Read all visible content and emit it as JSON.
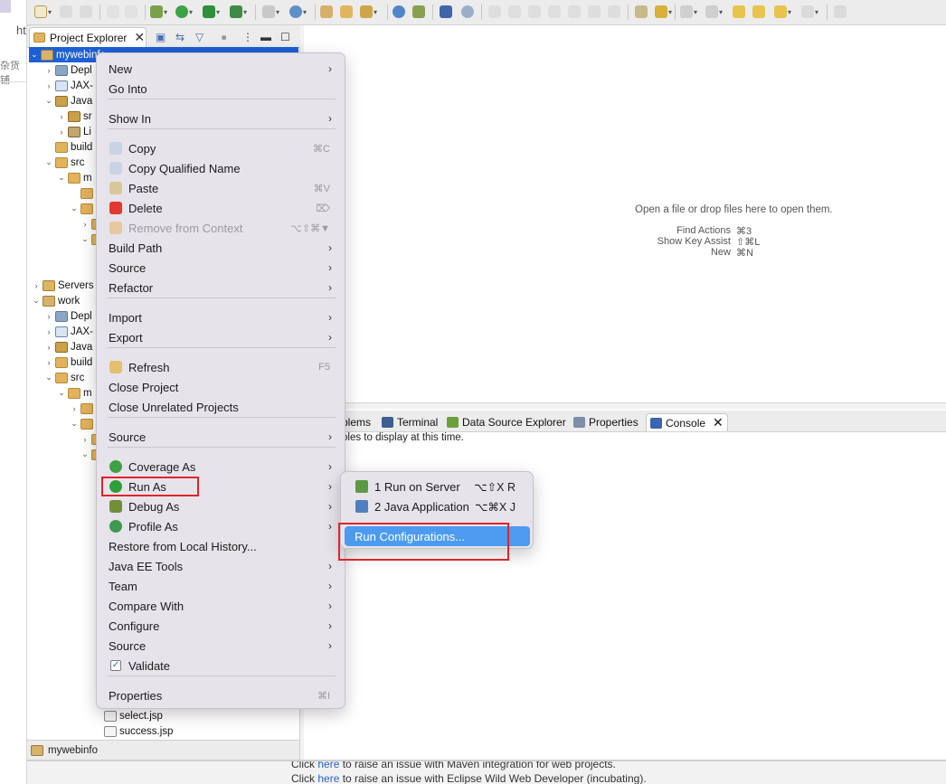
{
  "background": {
    "frag1": "ht",
    "frag2": "杂货铺"
  },
  "web_page": {
    "line1_prefix": "Click",
    "line1_link": "here",
    "line1_suffix": "to raise an issue with Maven integration for web projects.",
    "line2_prefix": "Click",
    "line2_link": "here",
    "line2_suffix": "to raise an issue with Eclipse Wild Web Developer (incubating)."
  },
  "explorer": {
    "tab_label": "Project Explorer",
    "close_glyph": "✕",
    "tree": [
      {
        "label": "mywebinfo",
        "arrow": "⌄",
        "icon": "proj"
      },
      {
        "label": "Depl",
        "arrow": "›",
        "icon": "deploy"
      },
      {
        "label": "JAX-",
        "arrow": "›",
        "icon": "jax"
      },
      {
        "label": "Java",
        "arrow": "⌄",
        "icon": "java"
      },
      {
        "label": "sr",
        "arrow": "›",
        "icon": "java"
      },
      {
        "label": "Li",
        "arrow": "›",
        "icon": "lib"
      },
      {
        "label": "build",
        "arrow": "",
        "icon": "folder"
      },
      {
        "label": "src",
        "arrow": "⌄",
        "icon": "folder"
      },
      {
        "label": "m",
        "arrow": "⌄",
        "icon": "folder"
      },
      {
        "label": "",
        "arrow": "",
        "icon": "folder"
      },
      {
        "label": "",
        "arrow": "⌄",
        "icon": "folder"
      },
      {
        "label": "",
        "arrow": "›",
        "icon": "folder"
      },
      {
        "label": "",
        "arrow": "⌄",
        "icon": "folder"
      },
      {
        "label": "Servers",
        "arrow": "›",
        "icon": "server"
      },
      {
        "label": "work",
        "arrow": "⌄",
        "icon": "proj"
      },
      {
        "label": "Depl",
        "arrow": "›",
        "icon": "deploy"
      },
      {
        "label": "JAX-",
        "arrow": "›",
        "icon": "jax"
      },
      {
        "label": "Java",
        "arrow": "›",
        "icon": "java"
      },
      {
        "label": "build",
        "arrow": "›",
        "icon": "folder"
      },
      {
        "label": "src",
        "arrow": "⌄",
        "icon": "folder"
      },
      {
        "label": "m",
        "arrow": "⌄",
        "icon": "folder"
      },
      {
        "label": "",
        "arrow": "›",
        "icon": "folder"
      },
      {
        "label": "",
        "arrow": "⌄",
        "icon": "folder"
      },
      {
        "label": "",
        "arrow": "›",
        "icon": "folder"
      },
      {
        "label": "",
        "arrow": "⌄",
        "icon": "folder"
      },
      {
        "label": "select.jsp",
        "arrow": "",
        "icon": "jsp"
      },
      {
        "label": "success.jsp",
        "arrow": "",
        "icon": "jsp"
      }
    ],
    "status_label": "mywebinfo"
  },
  "editor": {
    "hint_main": "Open a file or drop files here to open them.",
    "hints": [
      {
        "label": "Find Actions",
        "key": "⌘3"
      },
      {
        "label": "Show Key Assist",
        "key": "⇧⌘L"
      },
      {
        "label": "New",
        "key": "⌘N"
      }
    ]
  },
  "bottom_panel": {
    "tabs": [
      {
        "label": "blems",
        "icon_color": "#d26b3c"
      },
      {
        "label": "Terminal",
        "icon_color": "#3d5f8f"
      },
      {
        "label": "Data Source Explorer",
        "icon_color": "#6aa03c"
      },
      {
        "label": "Properties",
        "icon_color": "#7d8ea6"
      },
      {
        "label": "Console",
        "icon_color": "#3a64b4"
      }
    ],
    "close_glyph": "✕",
    "console_message": "oles to display at this time."
  },
  "context_menu": {
    "items": [
      {
        "label": "New",
        "arrow": "›",
        "shortcut": ""
      },
      {
        "label": "Go Into",
        "arrow": "",
        "shortcut": ""
      },
      {
        "label": "Show In",
        "arrow": "›",
        "shortcut": ""
      },
      {
        "label": "Copy",
        "arrow": "",
        "shortcut": "⌘C",
        "icon": "#c8d3e3"
      },
      {
        "label": "Copy Qualified Name",
        "arrow": "",
        "shortcut": "",
        "icon": "#c8d3e3"
      },
      {
        "label": "Paste",
        "arrow": "",
        "shortcut": "⌘V",
        "icon": "#d9c79b"
      },
      {
        "label": "Delete",
        "arrow": "",
        "shortcut": "⌦",
        "icon": "#e03a2e"
      },
      {
        "label": "Remove from Context",
        "arrow": "",
        "shortcut": "⌥⇧⌘▼",
        "icon": "#e6c9a0",
        "disabled": true
      },
      {
        "label": "Build Path",
        "arrow": "›",
        "shortcut": ""
      },
      {
        "label": "Source",
        "arrow": "›",
        "shortcut": ""
      },
      {
        "label": "Refactor",
        "arrow": "›",
        "shortcut": ""
      },
      {
        "label": "Import",
        "arrow": "›",
        "shortcut": ""
      },
      {
        "label": "Export",
        "arrow": "›",
        "shortcut": ""
      },
      {
        "label": "Refresh",
        "arrow": "",
        "shortcut": "F5",
        "icon": "#e2c070"
      },
      {
        "label": "Close Project",
        "arrow": "",
        "shortcut": ""
      },
      {
        "label": "Close Unrelated Projects",
        "arrow": "",
        "shortcut": ""
      },
      {
        "label": "Source",
        "arrow": "›",
        "shortcut": ""
      },
      {
        "label": "Coverage As",
        "arrow": "›",
        "shortcut": "",
        "icon": "#3fa046"
      },
      {
        "label": "Run As",
        "arrow": "›",
        "shortcut": "",
        "icon": "#2f9e3a"
      },
      {
        "label": "Debug As",
        "arrow": "›",
        "shortcut": "",
        "icon": "#6f8f3a"
      },
      {
        "label": "Profile As",
        "arrow": "›",
        "shortcut": "",
        "icon": "#3e9a50"
      },
      {
        "label": "Restore from Local History...",
        "arrow": "",
        "shortcut": ""
      },
      {
        "label": "Java EE Tools",
        "arrow": "›",
        "shortcut": ""
      },
      {
        "label": "Team",
        "arrow": "›",
        "shortcut": ""
      },
      {
        "label": "Compare With",
        "arrow": "›",
        "shortcut": ""
      },
      {
        "label": "Configure",
        "arrow": "›",
        "shortcut": ""
      },
      {
        "label": "Source",
        "arrow": "›",
        "shortcut": ""
      },
      {
        "label": "Validate",
        "arrow": "",
        "shortcut": ""
      },
      {
        "label": "Properties",
        "arrow": "",
        "shortcut": "⌘I"
      }
    ],
    "validate_checked": "✓"
  },
  "submenu": {
    "items": [
      {
        "label": "1 Run on Server",
        "shortcut": "⌥⇧X R",
        "icon": "#5a9a45"
      },
      {
        "label": "2 Java Application",
        "shortcut": "⌥⌘X J",
        "icon": "#4f7fbf"
      },
      {
        "label": "Run Configurations...",
        "shortcut": "",
        "highlight": true
      }
    ]
  },
  "colors": {
    "selection_blue": "#1e5fd4",
    "menu_bg": "#e7e3ea",
    "submenu_highlight": "#4c9bf0",
    "annotation_red": "#e0242b"
  }
}
